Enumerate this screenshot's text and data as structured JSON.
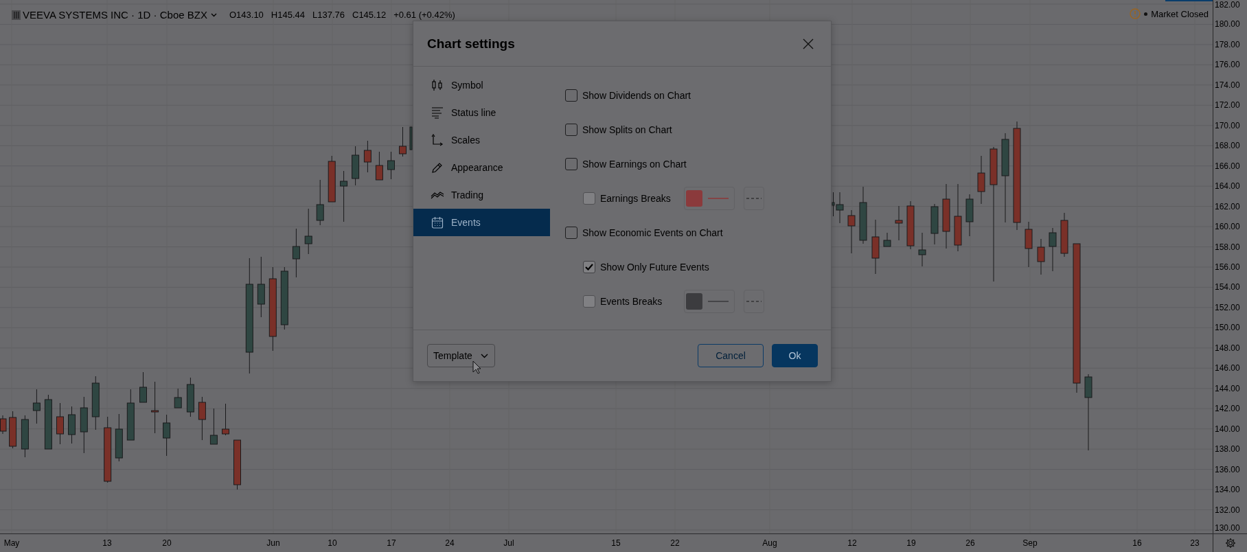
{
  "legend": {
    "title": "VEEVA SYSTEMS INC · 1D · Cboe BZX",
    "values": [
      "O143.10",
      "H145.44",
      "L137.76",
      "C145.12",
      "+0.61 (+0.42%)"
    ]
  },
  "market_status": {
    "label": "Market Closed"
  },
  "price_axis": {
    "labels": [
      "182.00",
      "180.00",
      "178.00",
      "176.00",
      "174.00",
      "172.00",
      "170.00",
      "168.00",
      "166.00",
      "164.00",
      "162.00",
      "160.00",
      "158.00",
      "156.00",
      "154.00",
      "152.00",
      "150.00",
      "148.00",
      "146.00",
      "144.00",
      "142.00",
      "140.00",
      "138.00",
      "136.00",
      "134.00",
      "132.00",
      "130.00"
    ]
  },
  "time_axis": {
    "labels": [
      "May",
      "13",
      "20",
      "Jun",
      "10",
      "17",
      "24",
      "Jul",
      "15",
      "22",
      "Aug",
      "12",
      "19",
      "26",
      "Sep",
      "16",
      "23"
    ]
  },
  "dialog": {
    "title": "Chart settings",
    "sidebar": [
      {
        "label": "Symbol",
        "selected": false
      },
      {
        "label": "Status line",
        "selected": false
      },
      {
        "label": "Scales",
        "selected": false
      },
      {
        "label": "Appearance",
        "selected": false
      },
      {
        "label": "Trading",
        "selected": false
      },
      {
        "label": "Events",
        "selected": true
      }
    ],
    "options": [
      {
        "label": "Show Dividends on Chart",
        "checked": false,
        "disabled": false
      },
      {
        "label": "Show Splits on Chart",
        "checked": false,
        "disabled": false
      },
      {
        "label": "Show Earnings on Chart",
        "checked": false,
        "disabled": false,
        "children": [
          {
            "label": "Earnings Breaks",
            "checked": false,
            "disabled": true,
            "color": "#8b3a3c",
            "dashed": true
          }
        ]
      },
      {
        "label": "Show Economic Events on Chart",
        "checked": false,
        "disabled": false,
        "children": [
          {
            "label": "Show Only Future Events",
            "checked": true,
            "disabled": true
          },
          {
            "label": "Events Breaks",
            "checked": false,
            "disabled": true,
            "color": "#3c3c3f",
            "dashed": true
          }
        ]
      }
    ],
    "template": {
      "label": "Template"
    },
    "buttons": [
      {
        "label": "Cancel",
        "kind": "secondary"
      },
      {
        "label": "Ok",
        "kind": "primary"
      }
    ]
  }
}
